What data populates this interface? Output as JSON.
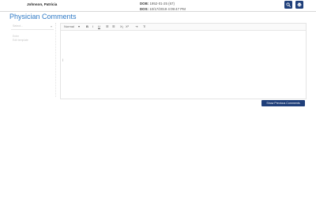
{
  "header": {
    "patient_name": "Johnson, Patricia",
    "dob_label": "DOB:",
    "dob_value": "1952-01-25 (67)",
    "dos_label": "DOS:",
    "dos_value": "10/17/2019 4:09:47 PM",
    "buttons": [
      {
        "icon": "search-icon"
      },
      {
        "icon": "print-icon"
      }
    ]
  },
  "page": {
    "title": "Physician Comments"
  },
  "left_panel": {
    "select_placeholder": "Select...",
    "select_arrow": "▾",
    "line1": "Enter",
    "line2": "Edit template"
  },
  "editor": {
    "toolbar": {
      "style_select": "Normal",
      "style_arrow": "▾",
      "bold": "B",
      "italic": "I",
      "underline": "U",
      "ordered_list": "☰",
      "bullet_list": "☰",
      "subscript": "X₂",
      "superscript": "X²",
      "indent": "⇥",
      "clear_format": "T̸"
    },
    "caret": "|"
  },
  "footer": {
    "show_previous_label": "Show Previous Comments"
  },
  "colors": {
    "accent_blue": "#2f7ac6",
    "button_navy": "#1f3f7a"
  }
}
